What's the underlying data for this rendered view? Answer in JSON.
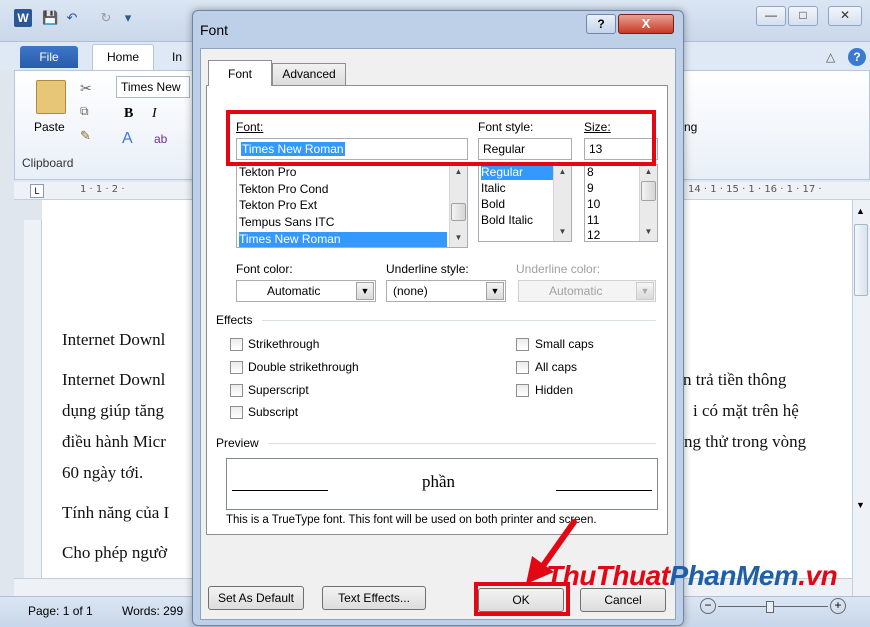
{
  "word": {
    "logo": "W",
    "tabs": [
      "File",
      "Home",
      "In"
    ],
    "ribbon": {
      "paste": "Paste",
      "clipboard": "Clipboard",
      "font_name": "Times New",
      "bold": "B",
      "italic": "I",
      "ng_fragment": "ng"
    },
    "ruler_left": "1 · 1 · 2 ·",
    "ruler_right": "14 · 1 · 15 · 1 · 16 · 1 · 17 ·",
    "document_lines": [
      "Internet Downl",
      "Internet Downl",
      "dụng giúp tăng",
      "điều hành Micr",
      "60 ngày tới.",
      "Tính năng của I",
      "Cho phép ngườ"
    ],
    "document_lines_right": [
      "n trả tiền thông",
      "i có mặt trên hệ",
      "ng thử trong vòng"
    ],
    "status": {
      "page": "Page: 1 of 1",
      "words": "Words: 299"
    }
  },
  "dialog": {
    "title": "Font",
    "help_btn": "?",
    "close_btn": "X",
    "tabs": {
      "font": "Font",
      "advanced": "Advanced"
    },
    "font_label": "Font:",
    "font_value": "Times New Roman",
    "font_list": [
      "Tekton Pro",
      "Tekton Pro Cond",
      "Tekton Pro Ext",
      "Tempus Sans ITC",
      "Times New Roman"
    ],
    "style_label": "Font style:",
    "style_value": "Regular",
    "style_list": [
      "Regular",
      "Italic",
      "Bold",
      "Bold Italic"
    ],
    "size_label": "Size:",
    "size_value": "13",
    "size_list": [
      "8",
      "9",
      "10",
      "11",
      "12"
    ],
    "font_color_label": "Font color:",
    "font_color_value": "Automatic",
    "underline_style_label": "Underline style:",
    "underline_style_value": "(none)",
    "underline_color_label": "Underline color:",
    "underline_color_value": "Automatic",
    "effects_label": "Effects",
    "effects_left": [
      "Strikethrough",
      "Double strikethrough",
      "Superscript",
      "Subscript"
    ],
    "effects_right": [
      "Small caps",
      "All caps",
      "Hidden"
    ],
    "preview_label": "Preview",
    "preview_text": "phần",
    "preview_note": "This is a TrueType font. This font will be used on both printer and screen.",
    "buttons": {
      "set_default": "Set As Default",
      "text_effects": "Text Effects...",
      "ok": "OK",
      "cancel": "Cancel"
    }
  },
  "watermark": {
    "part1": "ThuThuat",
    "part2": "PhanMem",
    "part3": ".vn"
  },
  "colors": {
    "highlight_red": "#e30613",
    "selection_blue": "#3399ff",
    "watermark_red": "#e30613",
    "watermark_blue": "#1f5fa8"
  }
}
